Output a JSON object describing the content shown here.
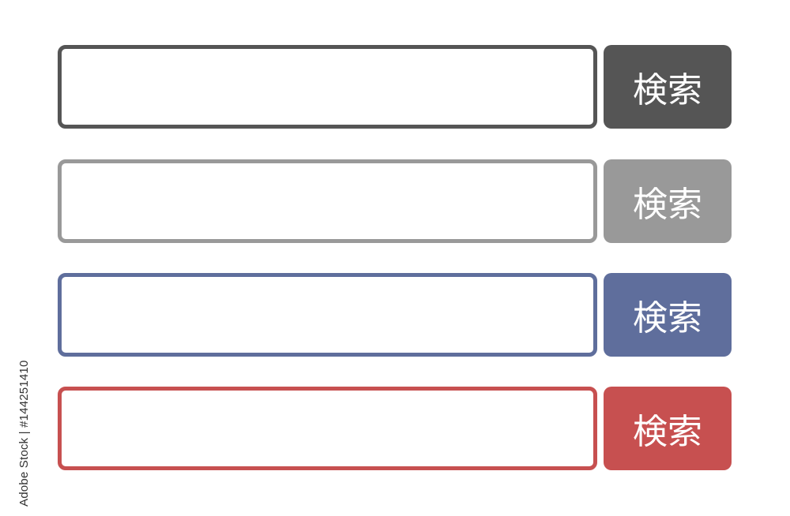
{
  "search_bars": [
    {
      "input_value": "",
      "button_label": "検索",
      "color": "#555555"
    },
    {
      "input_value": "",
      "button_label": "検索",
      "color": "#999999"
    },
    {
      "input_value": "",
      "button_label": "検索",
      "color": "#5f6e9c"
    },
    {
      "input_value": "",
      "button_label": "検索",
      "color": "#c75050"
    }
  ],
  "watermark": {
    "credit": "Adobe Stock | #144251410"
  }
}
